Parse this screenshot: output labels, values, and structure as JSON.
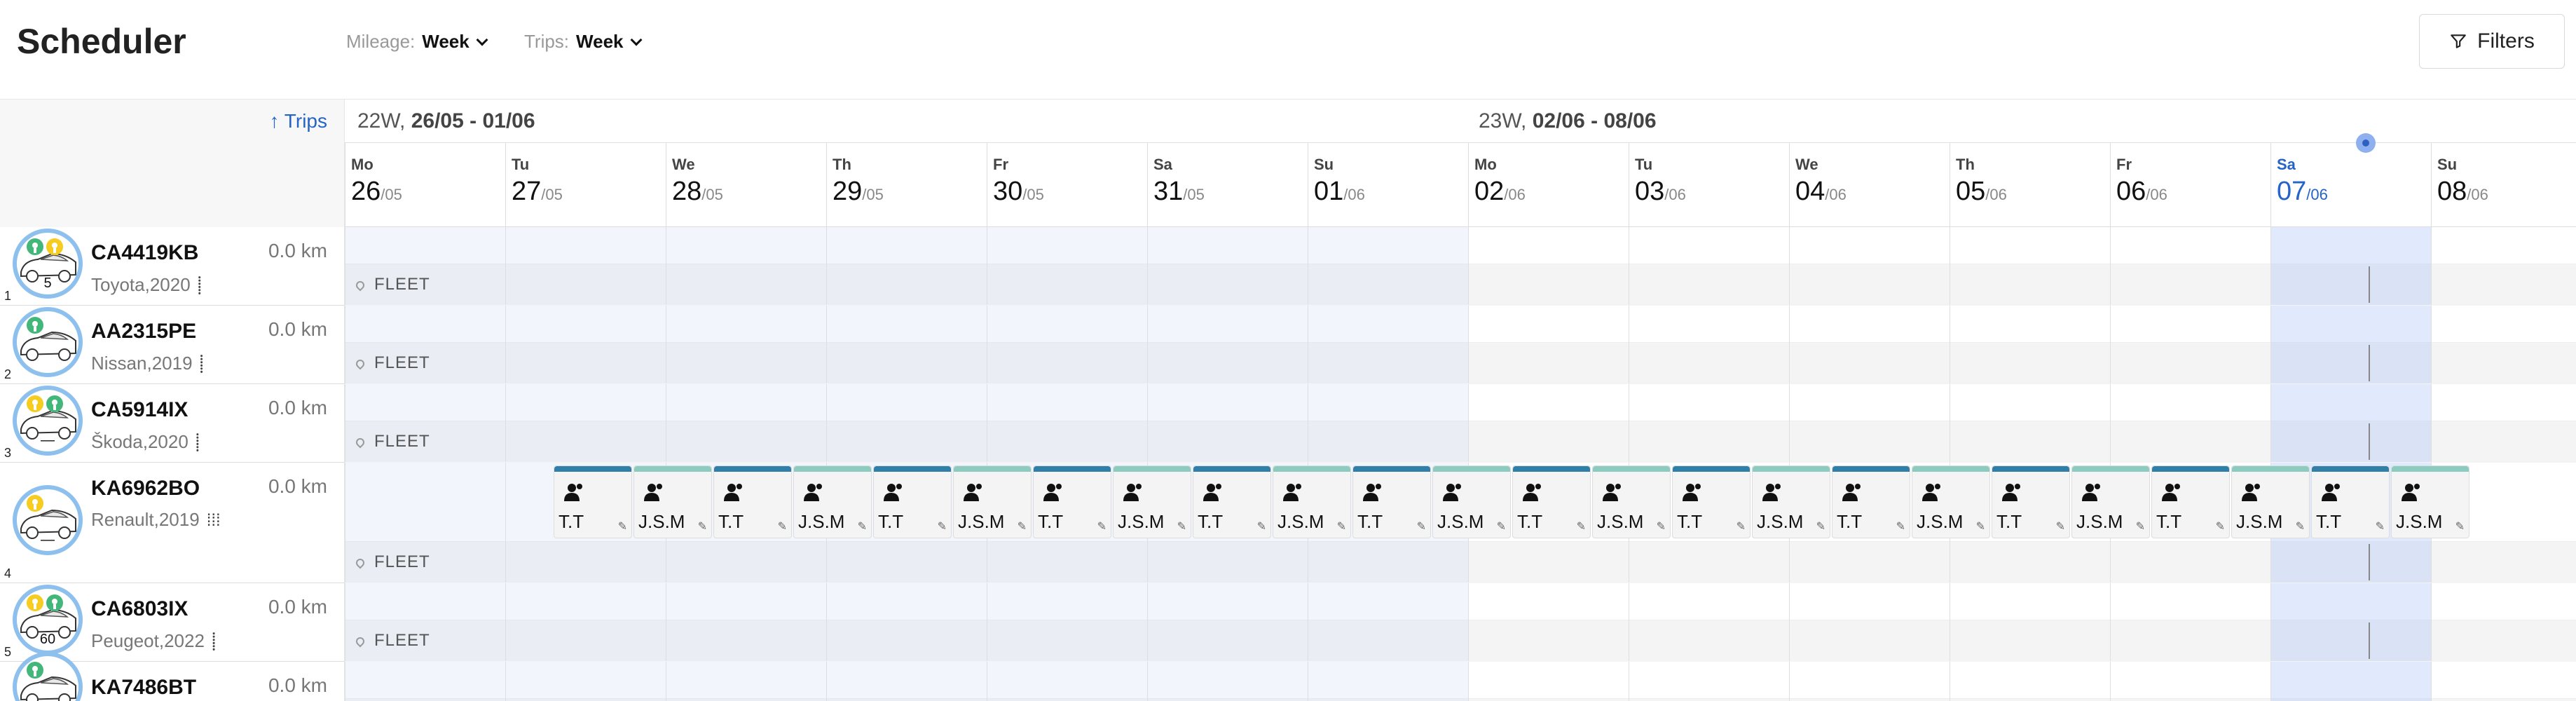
{
  "header": {
    "title": "Scheduler",
    "mileage_label": "Mileage:",
    "mileage_value": "Week",
    "trips_label": "Trips:",
    "trips_value": "Week",
    "filters_label": "Filters"
  },
  "sort": {
    "label": "↑ Trips"
  },
  "weeks": [
    {
      "num": "22W,",
      "range": "26/05 - 01/06"
    },
    {
      "num": "23W,",
      "range": "02/06 - 08/06"
    }
  ],
  "days": [
    {
      "name": "Mo",
      "day": "26",
      "month": "/05"
    },
    {
      "name": "Tu",
      "day": "27",
      "month": "/05"
    },
    {
      "name": "We",
      "day": "28",
      "month": "/05"
    },
    {
      "name": "Th",
      "day": "29",
      "month": "/05"
    },
    {
      "name": "Fr",
      "day": "30",
      "month": "/05"
    },
    {
      "name": "Sa",
      "day": "31",
      "month": "/05"
    },
    {
      "name": "Su",
      "day": "01",
      "month": "/06"
    },
    {
      "name": "Mo",
      "day": "02",
      "month": "/06"
    },
    {
      "name": "Tu",
      "day": "03",
      "month": "/06"
    },
    {
      "name": "We",
      "day": "04",
      "month": "/06"
    },
    {
      "name": "Th",
      "day": "05",
      "month": "/06"
    },
    {
      "name": "Fr",
      "day": "06",
      "month": "/06"
    },
    {
      "name": "Sa",
      "day": "07",
      "month": "/06",
      "today": true
    },
    {
      "name": "Su",
      "day": "08",
      "month": "/06"
    }
  ],
  "vehicles": [
    {
      "index": "1",
      "plate": "CA4419KB",
      "model": "Toyota,2020",
      "km": "0.0 km",
      "badge": "5",
      "icons": [
        "green",
        "yellow"
      ],
      "location": "FLEET",
      "transmission": "manual",
      "trips": false
    },
    {
      "index": "2",
      "plate": "AA2315PE",
      "model": "Nissan,2019",
      "km": "0.0 km",
      "badge": "",
      "icons": [
        "green"
      ],
      "location": "FLEET",
      "transmission": "manual",
      "trips": false
    },
    {
      "index": "3",
      "plate": "CA5914IX",
      "model": "Škoda,2020",
      "km": "0.0 km",
      "badge": "—",
      "icons": [
        "yellow",
        "green"
      ],
      "location": "FLEET",
      "transmission": "manual",
      "trips": false
    },
    {
      "index": "4",
      "plate": "KA6962BO",
      "model": "Renault,2019",
      "km": "0.0 km",
      "badge": "—",
      "icons": [
        "yellow"
      ],
      "location": "FLEET",
      "transmission": "auto",
      "trips": true
    },
    {
      "index": "5",
      "plate": "CA6803IX",
      "model": "Peugeot,2022",
      "km": "0.0 km",
      "badge": "60",
      "icons": [
        "yellow",
        "green"
      ],
      "location": "FLEET",
      "transmission": "manual",
      "trips": false
    },
    {
      "index": "6",
      "plate": "KA7486BT",
      "model": "",
      "km": "0.0 km",
      "badge": "",
      "icons": [
        "green"
      ],
      "location": "",
      "transmission": "",
      "trips": false
    }
  ],
  "trip_drivers": [
    "T.T",
    "J.S.M"
  ],
  "colors": {
    "accent": "#2563c9",
    "trip_bar_a": "#2f7fa8",
    "trip_bar_b": "#8ccbc0",
    "today_col": "#e3ebfb",
    "past_col": "#f3f6fb",
    "avatar_ring": "#8ec0ee",
    "status_green": "#43b77a",
    "status_yellow": "#f5cc1f"
  }
}
